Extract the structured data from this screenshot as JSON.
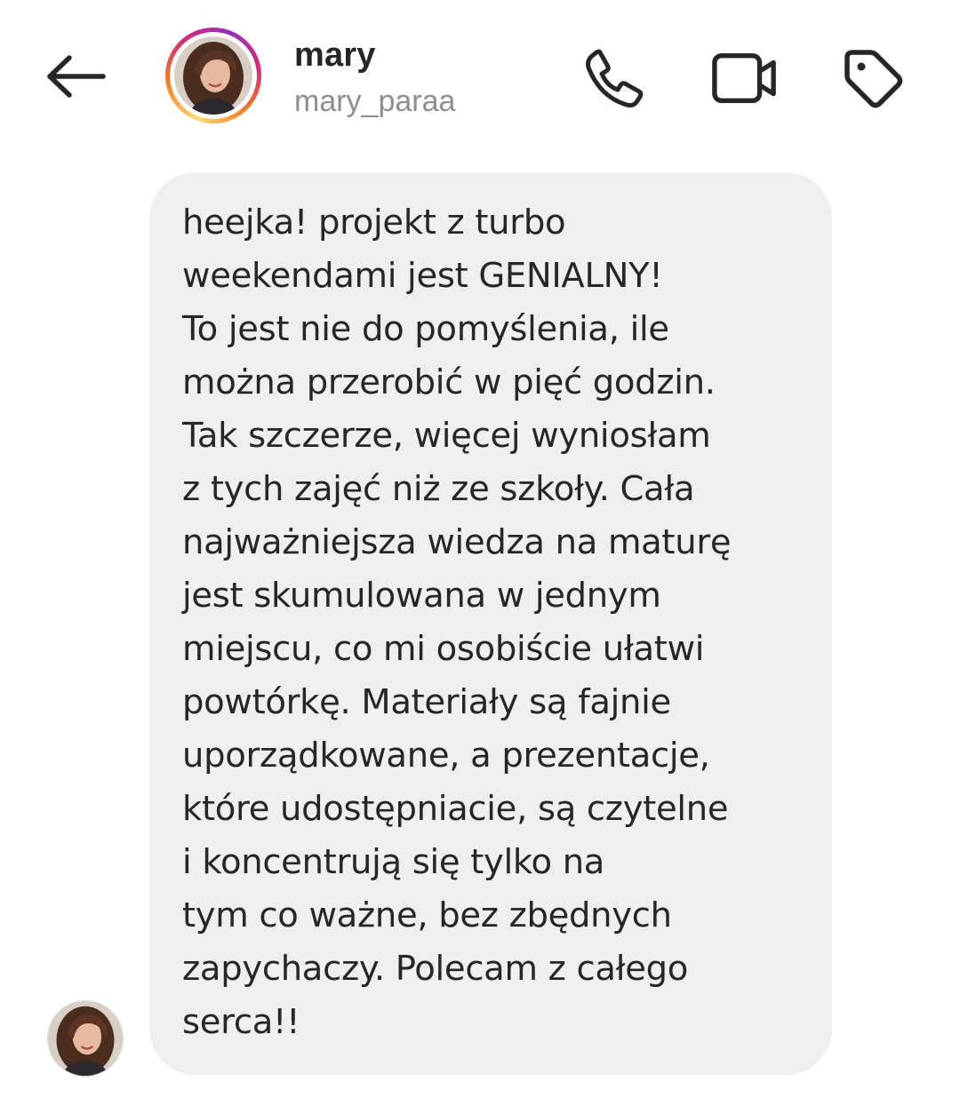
{
  "header": {
    "name": "mary",
    "username": "mary_paraa",
    "back_icon": "arrow-left-icon",
    "actions": [
      {
        "icon": "phone-icon"
      },
      {
        "icon": "video-camera-icon"
      },
      {
        "icon": "tag-icon"
      }
    ]
  },
  "message": {
    "lines": [
      "heejka! projekt z turbo",
      "weekendami jest GENIALNY!",
      "To jest nie do pomyślenia, ile",
      "można przerobić w pięć godzin.",
      "Tak szczerze, więcej wyniosłam",
      "z tych zajęć niż ze szkoły. Cała",
      "najważniejsza wiedza na maturę",
      "jest skumulowana w jednym",
      "miejscu, co mi osobiście ułatwi",
      "powtórkę. Materiały są fajnie",
      "uporządkowane, a prezentacje,",
      "które udostępniacie, są czytelne",
      "i koncentrują się tylko na",
      "tym co ważne, bez zbędnych",
      "zapychaczy. Polecam z całego",
      "serca!!"
    ]
  },
  "colors": {
    "bubble_bg": "#efefef",
    "text": "#262626",
    "secondary_text": "#8e8e8e",
    "story_ring": [
      "#feda75",
      "#fa7e1e",
      "#d62976",
      "#962fbf"
    ]
  }
}
